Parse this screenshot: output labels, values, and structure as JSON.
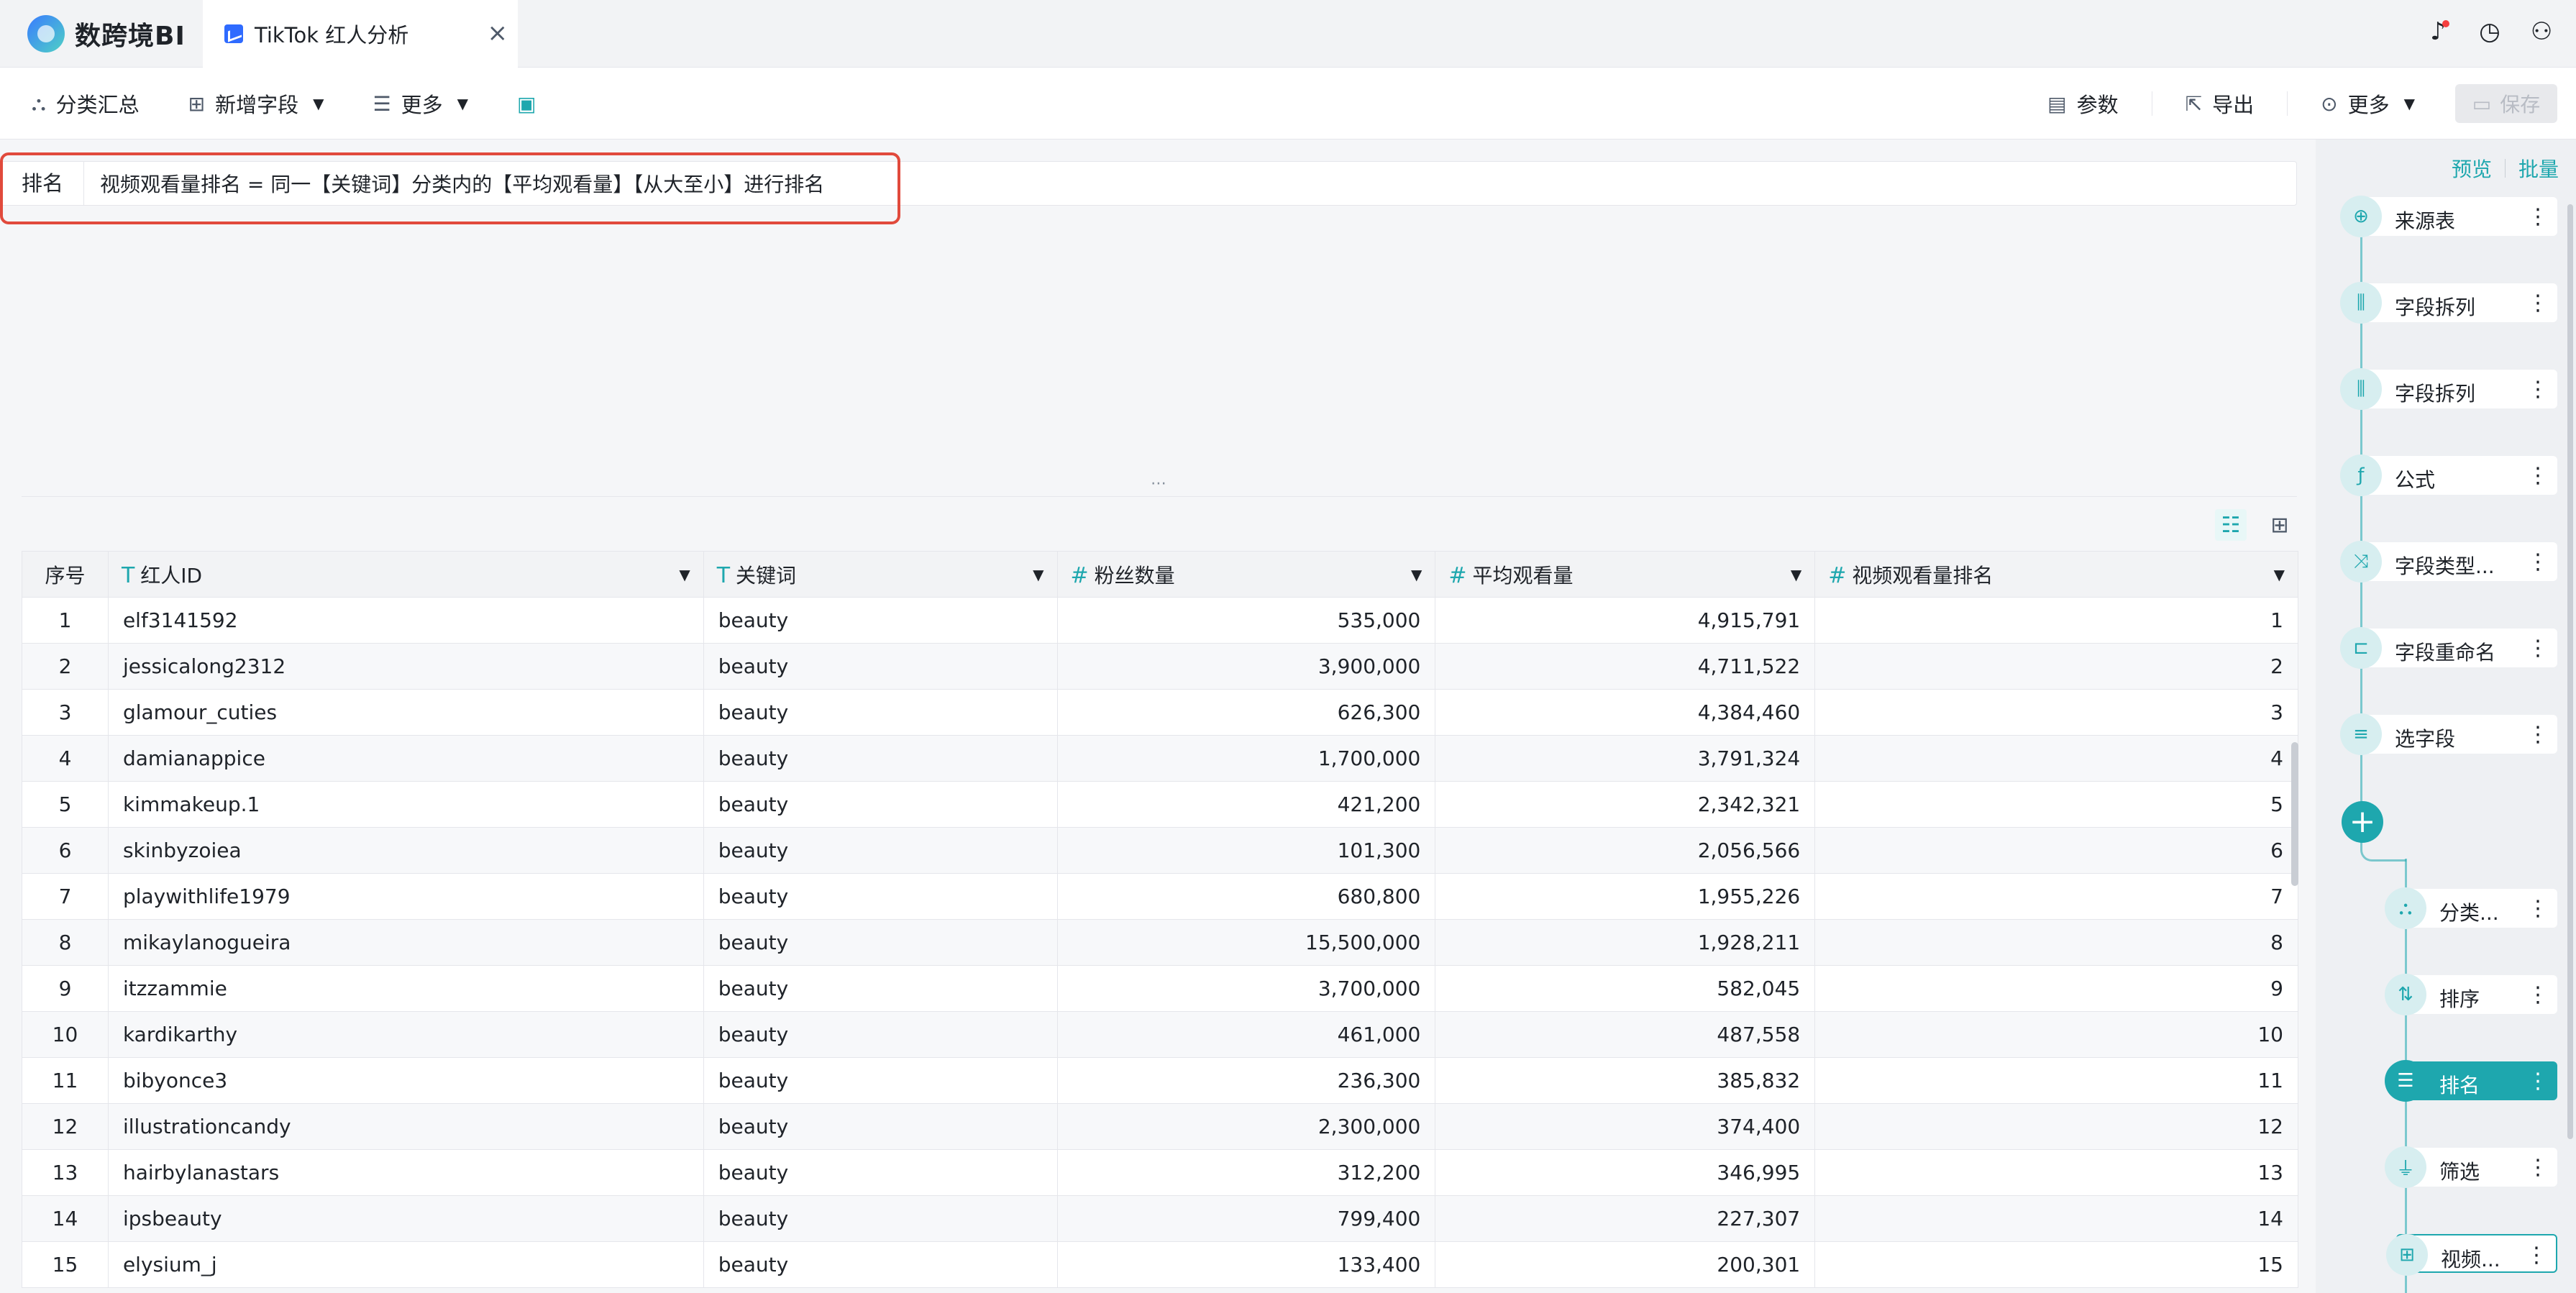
{
  "app": {
    "name": "数跨境BI"
  },
  "tab": {
    "title": "TikTok 红人分析",
    "close": "×"
  },
  "topbar": {
    "bell": "🔔",
    "timer": "⏱",
    "user": "👤"
  },
  "toolbar": {
    "left": [
      {
        "label": "分类汇总",
        "icon": "tree-icon"
      },
      {
        "label": "新增字段",
        "icon": "add-field-icon"
      },
      {
        "label": "更多",
        "icon": "list-icon"
      }
    ],
    "params_label": "参数",
    "export_label": "导出",
    "more_label": "更多",
    "save_label": "保存"
  },
  "formula": {
    "label": "排名",
    "text": "视频观看量排名 = 同一【关键词】分类内的【平均观看量】【从大至小】进行排名"
  },
  "table": {
    "columns": [
      {
        "label": "序号"
      },
      {
        "label": "红人ID",
        "type": "T"
      },
      {
        "label": "关键词",
        "type": "T"
      },
      {
        "label": "粉丝数量",
        "type": "#"
      },
      {
        "label": "平均观看量",
        "type": "#"
      },
      {
        "label": "视频观看量排名",
        "type": "#"
      }
    ],
    "rows": [
      [
        "1",
        "elf3141592",
        "beauty",
        "535,000",
        "4,915,791",
        "1"
      ],
      [
        "2",
        "jessicalong2312",
        "beauty",
        "3,900,000",
        "4,711,522",
        "2"
      ],
      [
        "3",
        "glamour_cuties",
        "beauty",
        "626,300",
        "4,384,460",
        "3"
      ],
      [
        "4",
        "damianappice",
        "beauty",
        "1,700,000",
        "3,791,324",
        "4"
      ],
      [
        "5",
        "kimmakeup.1",
        "beauty",
        "421,200",
        "2,342,321",
        "5"
      ],
      [
        "6",
        "skinbyzoiea",
        "beauty",
        "101,300",
        "2,056,566",
        "6"
      ],
      [
        "7",
        "playwithlife1979",
        "beauty",
        "680,800",
        "1,955,226",
        "7"
      ],
      [
        "8",
        "mikaylanogueira",
        "beauty",
        "15,500,000",
        "1,928,211",
        "8"
      ],
      [
        "9",
        "itzzammie",
        "beauty",
        "3,700,000",
        "582,045",
        "9"
      ],
      [
        "10",
        "kardikarthy",
        "beauty",
        "461,000",
        "487,558",
        "10"
      ],
      [
        "11",
        "bibyonce3",
        "beauty",
        "236,300",
        "385,832",
        "11"
      ],
      [
        "12",
        "illustrationcandy",
        "beauty",
        "2,300,000",
        "374,400",
        "12"
      ],
      [
        "13",
        "hairbylanastars",
        "beauty",
        "312,200",
        "346,995",
        "13"
      ],
      [
        "14",
        "ipsbeauty",
        "beauty",
        "799,400",
        "227,307",
        "14"
      ],
      [
        "15",
        "elysium_j",
        "beauty",
        "133,400",
        "200,301",
        "15"
      ]
    ]
  },
  "panel": {
    "preview": "预览",
    "batch": "批量",
    "steps": [
      {
        "label": "来源表",
        "icon": "source-icon"
      },
      {
        "label": "字段拆列",
        "icon": "split-icon"
      },
      {
        "label": "字段拆列",
        "icon": "split-icon"
      },
      {
        "label": "公式",
        "icon": "formula-icon"
      },
      {
        "label": "字段类型...",
        "icon": "shuffle-icon"
      },
      {
        "label": "字段重命名",
        "icon": "rename-icon"
      },
      {
        "label": "选字段",
        "icon": "select-icon"
      }
    ],
    "branch_steps": [
      {
        "label": "分类...",
        "icon": "tree-icon"
      },
      {
        "label": "排序",
        "icon": "sort-icon"
      },
      {
        "label": "排名",
        "icon": "rank-icon"
      },
      {
        "label": "筛选",
        "icon": "filter-icon"
      },
      {
        "label": "视频...",
        "icon": "output-icon"
      }
    ]
  }
}
